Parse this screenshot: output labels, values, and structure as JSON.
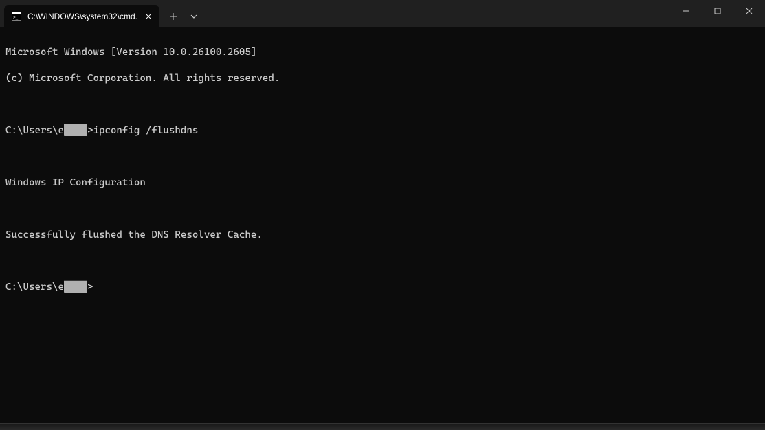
{
  "titlebar": {
    "tab": {
      "title": "C:\\WINDOWS\\system32\\cmd.",
      "icon": "cmd-icon"
    }
  },
  "terminal": {
    "line1": "Microsoft Windows [Version 10.0.26100.2605]",
    "line2": "(c) Microsoft Corporation. All rights reserved.",
    "prompt1_prefix": "C:\\Users\\e",
    "prompt1_redacted": "████",
    "prompt1_suffix": ">ipconfig /flushdns",
    "output1": "Windows IP Configuration",
    "output2": "Successfully flushed the DNS Resolver Cache.",
    "prompt2_prefix": "C:\\Users\\e",
    "prompt2_redacted": "████",
    "prompt2_suffix": ">"
  }
}
